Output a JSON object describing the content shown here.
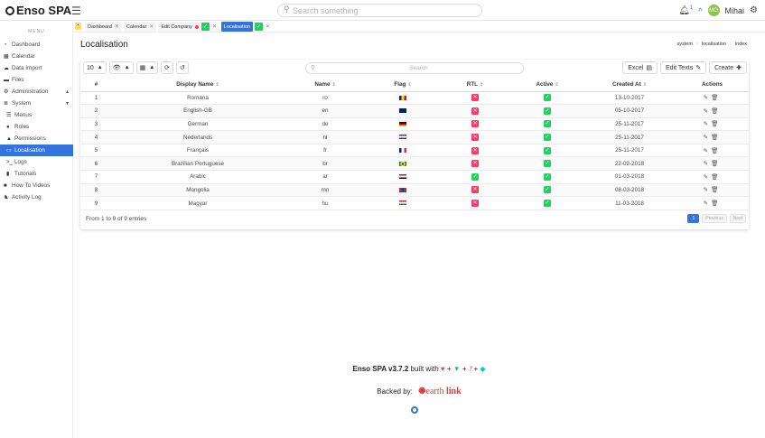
{
  "app": {
    "brand": "Enso SPA",
    "search_placeholder": "Search something",
    "notifications_count": "1",
    "user_initials": "MO",
    "user_name": "Mihai"
  },
  "tabs": [
    {
      "label": "Dashboard",
      "closable": true
    },
    {
      "label": "Calendar",
      "closable": true
    },
    {
      "label": "Edit Company",
      "closable": true,
      "dirty": true
    },
    {
      "label": "Localisation",
      "closable": true,
      "active": true
    }
  ],
  "sidebar": {
    "menu_label": "MENU",
    "items": [
      {
        "label": "Dashboard",
        "icon": "tachometer-icon"
      },
      {
        "label": "Calendar",
        "icon": "calendar-icon"
      },
      {
        "label": "Data Import",
        "icon": "cloud-upload-icon"
      },
      {
        "label": "Files",
        "icon": "folder-icon"
      },
      {
        "label": "Administration",
        "icon": "cogs-icon"
      },
      {
        "label": "System",
        "icon": "server-icon"
      },
      {
        "label": "Menus",
        "icon": "list-icon"
      },
      {
        "label": "Roles",
        "icon": "user-tie-icon"
      },
      {
        "label": "Permissions",
        "icon": "exclamation-triangle-icon"
      },
      {
        "label": "Localisation",
        "icon": "language-icon"
      },
      {
        "label": "Logs",
        "icon": "terminal-icon"
      },
      {
        "label": "Tutorials",
        "icon": "book-icon"
      },
      {
        "label": "How To Videos",
        "icon": "video-icon"
      },
      {
        "label": "Activity Log",
        "icon": "user-secret-icon"
      }
    ]
  },
  "page": {
    "title": "Localisation",
    "breadcrumb": [
      "system",
      "localisation",
      "index"
    ]
  },
  "table": {
    "page_size": "10",
    "search_placeholder": "Search",
    "buttons": {
      "excel": "Excel",
      "edit_texts": "Edit Texts",
      "create": "Create"
    },
    "columns": [
      "#",
      "Display Name",
      "Name",
      "Flag",
      "RTL",
      "Active",
      "Created At",
      "Actions"
    ],
    "rows": [
      {
        "n": "1",
        "display": "Romana",
        "name": "ro",
        "flag": "ro",
        "rtl": false,
        "active": true,
        "created": "13-10-2017"
      },
      {
        "n": "2",
        "display": "English-GB",
        "name": "en",
        "flag": "gb",
        "rtl": false,
        "active": true,
        "created": "05-10-2017"
      },
      {
        "n": "3",
        "display": "German",
        "name": "de",
        "flag": "de",
        "rtl": false,
        "active": true,
        "created": "25-11-2017"
      },
      {
        "n": "4",
        "display": "Nederlands",
        "name": "nl",
        "flag": "nl",
        "rtl": false,
        "active": true,
        "created": "25-11-2017"
      },
      {
        "n": "5",
        "display": "Français",
        "name": "fr",
        "flag": "fr",
        "rtl": false,
        "active": true,
        "created": "25-11-2017"
      },
      {
        "n": "6",
        "display": "Brazilian Portuguese",
        "name": "br",
        "flag": "br",
        "rtl": false,
        "active": true,
        "created": "22-02-2018"
      },
      {
        "n": "7",
        "display": "Arabic",
        "name": "ar",
        "flag": "eg",
        "rtl": true,
        "active": true,
        "created": "01-03-2018"
      },
      {
        "n": "8",
        "display": "Mongolia",
        "name": "mn",
        "flag": "mn",
        "rtl": false,
        "active": true,
        "created": "08-03-2018"
      },
      {
        "n": "9",
        "display": "Magyar",
        "name": "hu",
        "flag": "hu",
        "rtl": false,
        "active": true,
        "created": "11-03-2018"
      }
    ],
    "entries_text": "From 1 to 9 of 9 entries",
    "pager": {
      "current": "1",
      "previous": "Previous",
      "next": "Next"
    }
  },
  "footer": {
    "version_text": "Enso SPA v3.7.2",
    "built_with": "built with",
    "backed_by": "Backed by:",
    "sponsor_prefix": "earth",
    "sponsor_suffix": "link"
  },
  "colors": {
    "primary": "#3273dc",
    "success": "#23d160",
    "danger": "#ff3860",
    "warning": "#ffdd57"
  }
}
